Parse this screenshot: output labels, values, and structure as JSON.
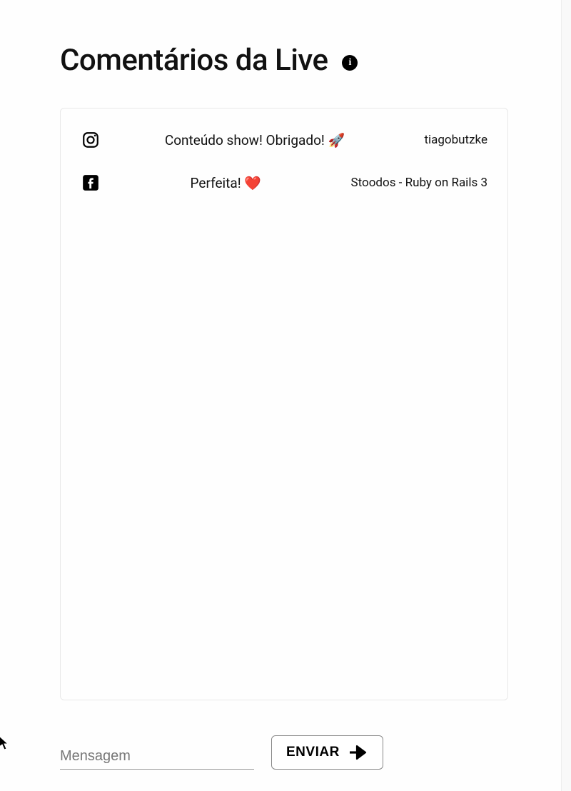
{
  "header": {
    "title": "Comentários da Live"
  },
  "comments": [
    {
      "platform": "instagram",
      "text": "Conteúdo show! Obrigado! 🚀",
      "user": "tiagobutzke"
    },
    {
      "platform": "facebook",
      "text": "Perfeita! ❤️",
      "user": "Stoodos - Ruby on Rails 3"
    }
  ],
  "footer": {
    "message_placeholder": "Mensagem",
    "send_label": "ENVIAR"
  }
}
